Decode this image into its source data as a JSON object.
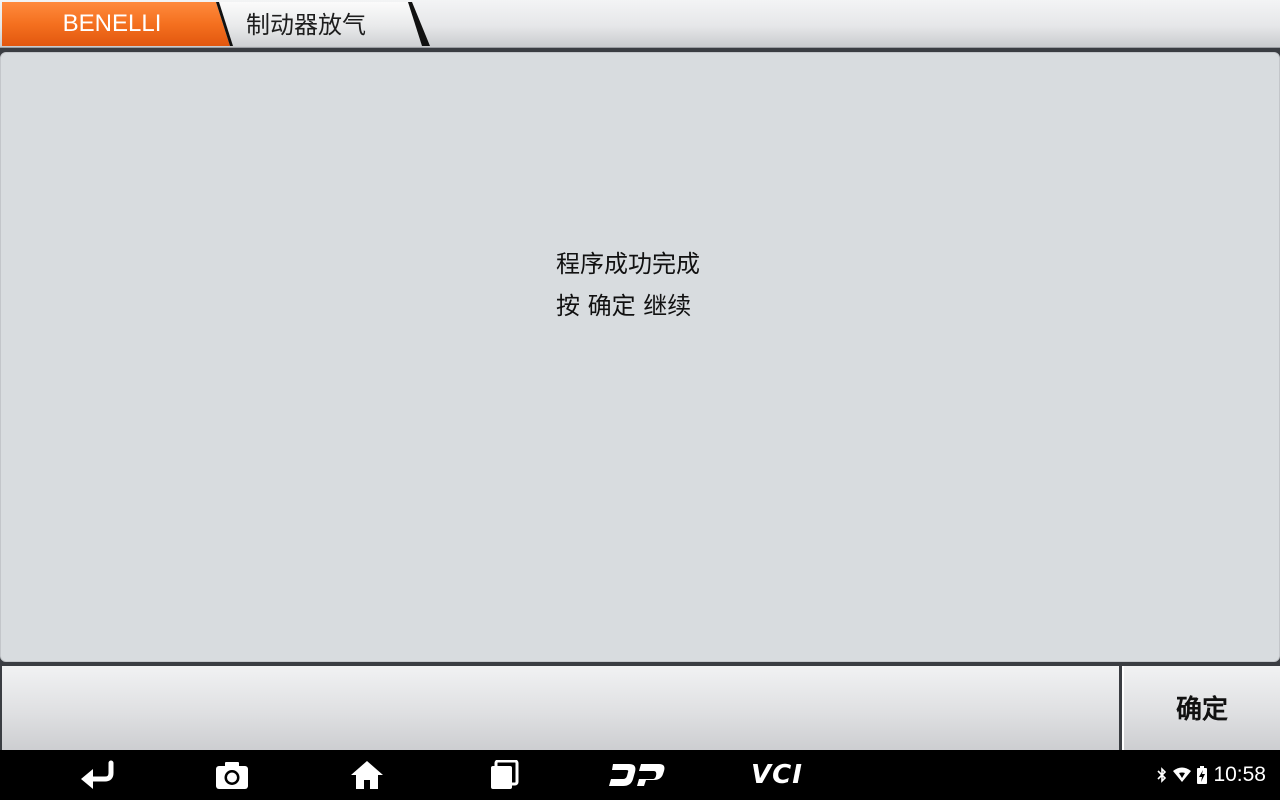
{
  "breadcrumb": {
    "brand": "BENELLI",
    "page": "制动器放气"
  },
  "message": {
    "line1": "程序成功完成",
    "line2": "按 确定 继续"
  },
  "actions": {
    "ok_label": "确定"
  },
  "navbar": {
    "items": [
      "back-icon",
      "camera-icon",
      "home-icon",
      "recent-apps-icon",
      "dp-logo-icon",
      "vci-icon"
    ],
    "vci_label": "VCI"
  },
  "status": {
    "time": "10:58",
    "icons": [
      "bluetooth-icon",
      "wifi-icon",
      "battery-icon"
    ]
  },
  "colors": {
    "brand_orange": "#f26a1b",
    "panel_bg": "#d8dcdf"
  }
}
